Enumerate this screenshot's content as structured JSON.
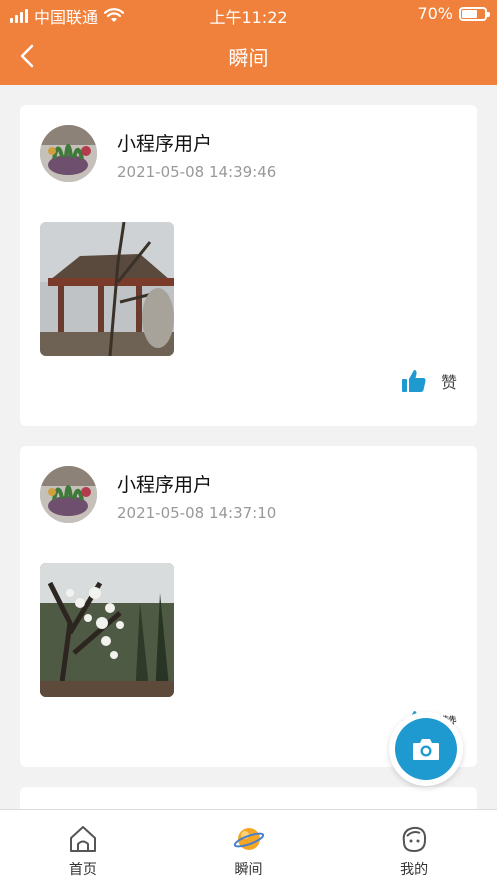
{
  "status_bar": {
    "carrier": "中国联通",
    "time": "上午11:22",
    "battery_text": "70%",
    "battery_level": 0.7
  },
  "nav": {
    "title": "瞬间",
    "back_icon": "chevron-left-icon"
  },
  "colors": {
    "header": "#f0813c",
    "accent": "#1e9ad0",
    "background": "#f2f2f2"
  },
  "posts": [
    {
      "username": "小程序用户",
      "time": "2021-05-08 14:39:46",
      "like_label": "赞",
      "photo_icon": "pavilion-photo"
    },
    {
      "username": "小程序用户",
      "time": "2021-05-08 14:37:10",
      "like_label": "赞",
      "photo_icon": "blossom-tree-photo"
    }
  ],
  "fab": {
    "icon": "camera-icon"
  },
  "tabs": [
    {
      "label": "首页",
      "icon": "home-icon"
    },
    {
      "label": "瞬间",
      "icon": "planet-icon",
      "active": true
    },
    {
      "label": "我的",
      "icon": "profile-face-icon"
    }
  ]
}
